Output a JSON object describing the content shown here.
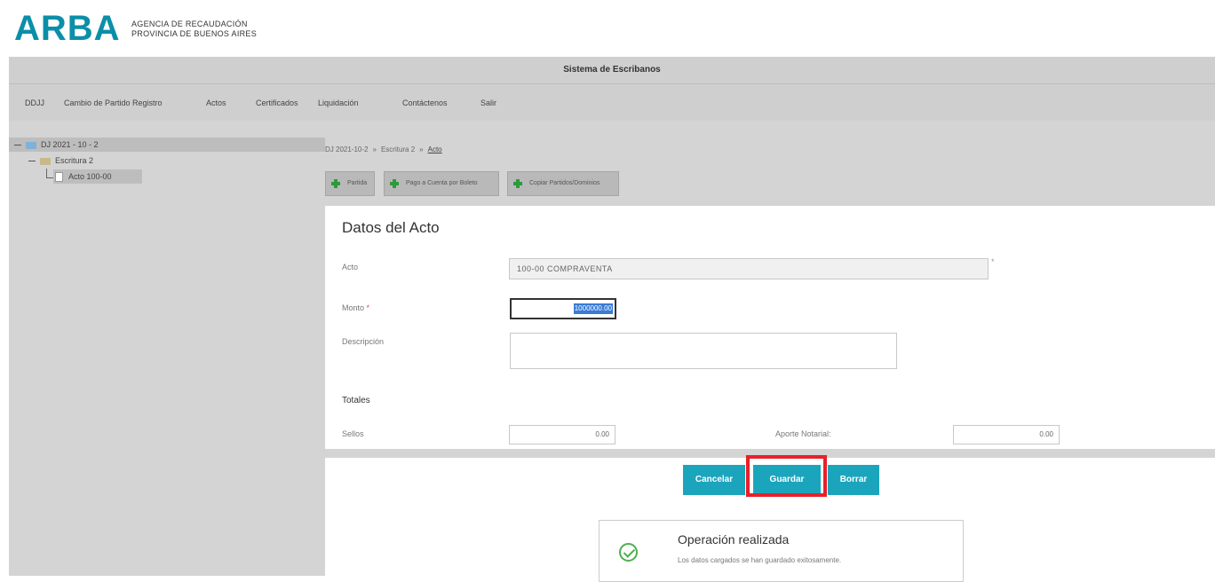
{
  "logo": {
    "word": "ARBA",
    "sub_line1": "AGENCIA DE RECAUDACIÓN",
    "sub_line2": "PROVINCIA DE BUENOS AIRES"
  },
  "header": {
    "title": "Sistema de Escribanos"
  },
  "menu": [
    {
      "label": "DDJJ"
    },
    {
      "label": "Cambio de Partido Registro"
    },
    {
      "label": "Actos"
    },
    {
      "label": "Certificados"
    },
    {
      "label": "Liquidación"
    },
    {
      "label": "Contáctenos"
    },
    {
      "label": "Salir"
    }
  ],
  "tree": {
    "root": "DJ 2021 - 10 - 2",
    "child": "Escritura 2",
    "leaf": "Acto 100-00"
  },
  "breadcrumb": {
    "item1": "DJ 2021-10-2",
    "item2": "Escritura 2",
    "current": "Acto",
    "separator": "»"
  },
  "toolbar": {
    "partida": "Partida",
    "pago": "Pago a Cuenta por Boleto",
    "copiar": "Copiar Partidos/Dominios"
  },
  "form": {
    "title": "Datos del Acto",
    "acto_label": "Acto",
    "acto_value": "100-00 COMPRAVENTA",
    "acto_marker": "*",
    "monto_label": "Monto",
    "required_mark": "*",
    "monto_value": "1000000.00",
    "descripcion_label": "Descripción",
    "descripcion_value": "",
    "totales_label": "Totales",
    "sellos_label": "Sellos",
    "sellos_value": "0.00",
    "aporte_label": "Aporte Notarial:",
    "aporte_value": "0.00"
  },
  "actions": {
    "cancelar": "Cancelar",
    "guardar": "Guardar",
    "borrar": "Borrar"
  },
  "toast": {
    "title": "Operación realizada",
    "message": "Los datos cargados se han guardado exitosamente."
  },
  "colors": {
    "brand": "#0b8fa8",
    "button": "#1ba5bd",
    "highlight": "#e8202a",
    "success": "#4caf50",
    "panel_gray": "#d4d4d4"
  }
}
